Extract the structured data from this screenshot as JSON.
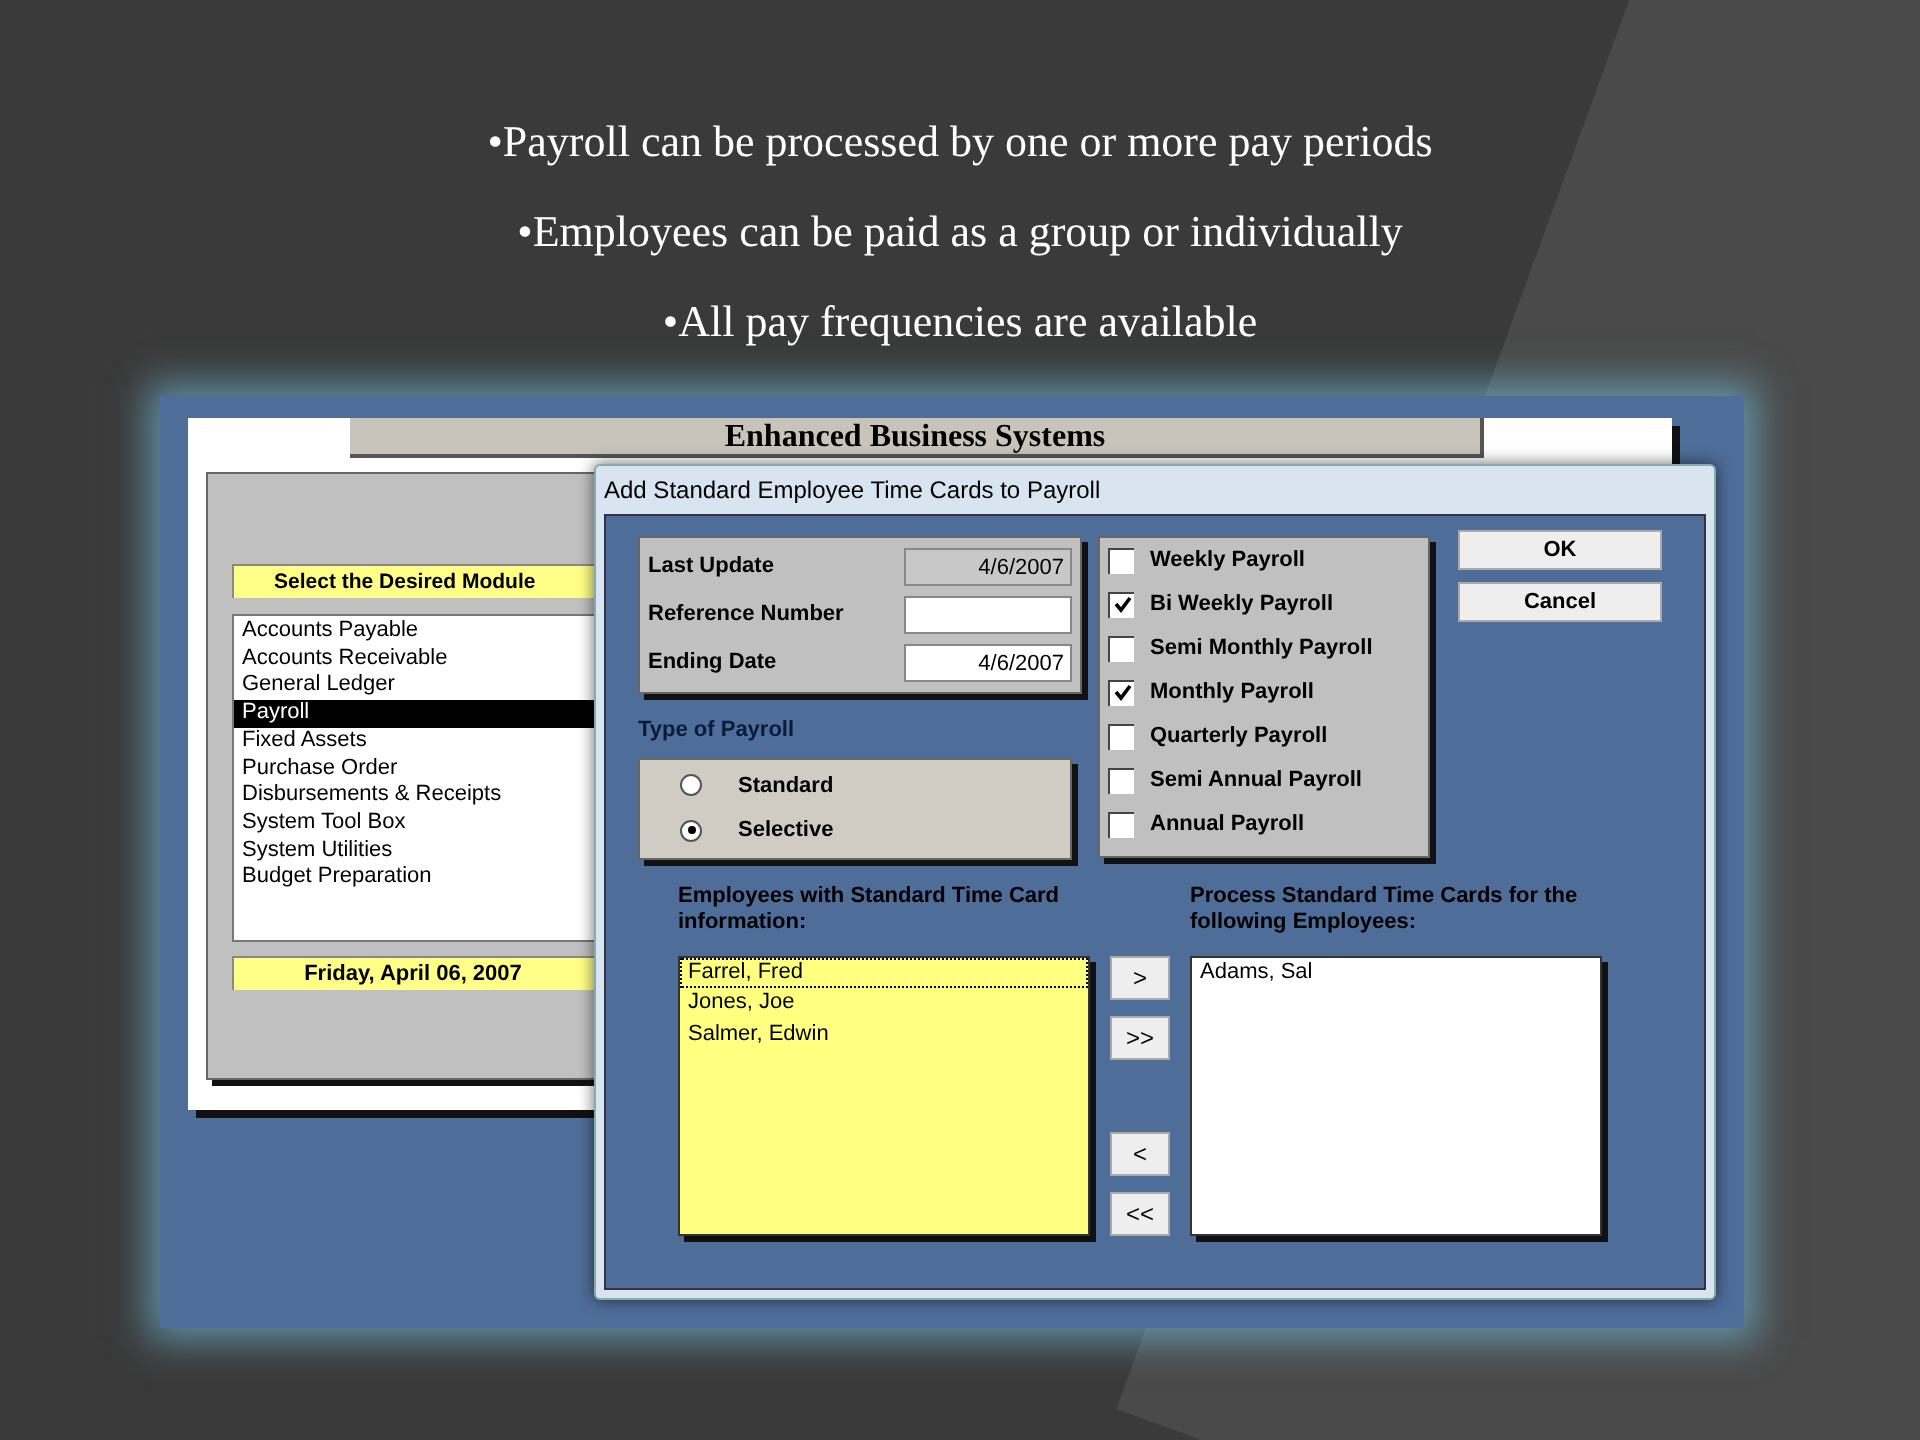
{
  "slide": {
    "bullets": [
      "•Payroll can be processed by one or more pay periods",
      "•Employees can be paid as a group or individually",
      "•All pay frequencies are available"
    ]
  },
  "back_window": {
    "title": "Enhanced Business Systems",
    "module_heading": "Select the Desired Module",
    "date": "Friday, April 06, 2007",
    "modules": [
      {
        "label": "Accounts Payable",
        "selected": false
      },
      {
        "label": "Accounts Receivable",
        "selected": false
      },
      {
        "label": "General Ledger",
        "selected": false
      },
      {
        "label": "Payroll",
        "selected": true
      },
      {
        "label": "Fixed Assets",
        "selected": false
      },
      {
        "label": "Purchase Order",
        "selected": false
      },
      {
        "label": "Disbursements & Receipts",
        "selected": false
      },
      {
        "label": "System Tool Box",
        "selected": false
      },
      {
        "label": "System Utilities",
        "selected": false
      },
      {
        "label": "Budget Preparation",
        "selected": false
      }
    ]
  },
  "dialog": {
    "title": "Add Standard Employee Time Cards to Payroll",
    "fields": [
      {
        "label": "Last Update",
        "value": "4/6/2007",
        "disabled": true
      },
      {
        "label": "Reference Number",
        "disabled": false
      },
      {
        "label": "Ending Date",
        "value": "4/6/2007",
        "disabled": false
      }
    ],
    "payroll_type_heading": "Type of Payroll",
    "payroll_types": [
      {
        "label": "Standard",
        "selected": false
      },
      {
        "label": "Selective",
        "selected": true
      }
    ],
    "frequencies": [
      {
        "label": "Weekly Payroll",
        "checked": false
      },
      {
        "label": "Bi Weekly Payroll",
        "checked": true
      },
      {
        "label": "Semi Monthly Payroll",
        "checked": false
      },
      {
        "label": "Monthly Payroll",
        "checked": true
      },
      {
        "label": "Quarterly Payroll",
        "checked": false
      },
      {
        "label": "Semi Annual Payroll",
        "checked": false
      },
      {
        "label": "Annual Payroll",
        "checked": false
      }
    ],
    "buttons": [
      "OK",
      "Cancel"
    ],
    "available_heading": "Employees with Standard Time Card information:",
    "available": [
      {
        "label": "Farrel, Fred",
        "selected": true
      },
      {
        "label": "Jones, Joe",
        "selected": false
      },
      {
        "label": "Salmer, Edwin",
        "selected": false
      }
    ],
    "move_buttons": [
      ">",
      ">>",
      "<",
      "<<"
    ],
    "chosen_heading": "Process Standard Time Cards for the following Employees:",
    "chosen": [
      {
        "label": "Adams, Sal",
        "selected": false
      }
    ]
  }
}
